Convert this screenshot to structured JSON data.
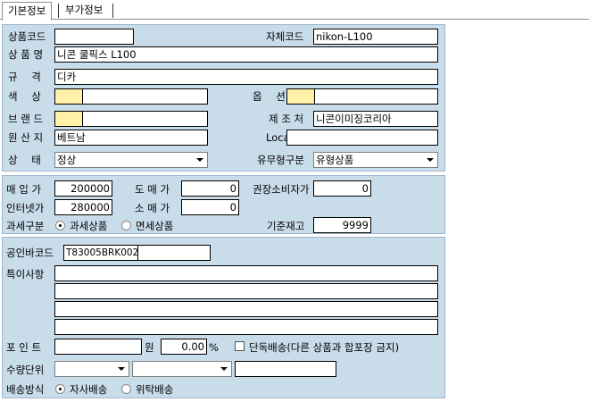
{
  "tabs": [
    {
      "label": "기본정보",
      "active": true
    },
    {
      "label": "부가정보",
      "active": false
    }
  ],
  "basic": {
    "product_code": {
      "label": "상품코드",
      "value": ""
    },
    "own_code": {
      "label": "자체코드",
      "value": "nikon-L100"
    },
    "product_name": {
      "label": "상 품 명",
      "value": "니콘 쿨픽스 L100"
    },
    "spec": {
      "label": "규     격",
      "value": "디카"
    },
    "color": {
      "label": "색     상",
      "value": ""
    },
    "option": {
      "label": "옵     션",
      "value": ""
    },
    "brand": {
      "label": "브 랜 드",
      "value": ""
    },
    "maker": {
      "label": "제 조 처",
      "value": "니콘이미징코리아"
    },
    "origin": {
      "label": "원 산 지",
      "value": "베트남"
    },
    "location": {
      "label": "Location",
      "value": ""
    },
    "status": {
      "label": "상     태",
      "value": "정상"
    },
    "type": {
      "label": "유무형구분",
      "value": "유형상품"
    }
  },
  "price": {
    "purchase": {
      "label": "매 입 가",
      "value": "200000"
    },
    "wholesale": {
      "label": "도 매 가",
      "value": "0"
    },
    "msrp": {
      "label": "권장소비자가",
      "value": "0"
    },
    "online": {
      "label": "인터넷가",
      "value": "280000"
    },
    "retail": {
      "label": "소 매 가",
      "value": "0"
    },
    "tax_label": "과세구분",
    "tax_options": [
      "과세상품",
      "면세상품"
    ],
    "tax_selected": 0,
    "stock": {
      "label": "기준재고",
      "value": "9999"
    }
  },
  "extra": {
    "barcode": {
      "label": "공인바코드",
      "value": "T83005BRK002",
      "value2": ""
    },
    "notes": {
      "label": "특이사항",
      "lines": [
        "",
        "",
        "",
        ""
      ]
    },
    "point": {
      "label": "포 인 트",
      "value": "",
      "unit": "원",
      "rate": "0.00",
      "rate_unit": "%"
    },
    "single_ship": {
      "label": "단독배송(다른 상품과 합포장 금지)",
      "checked": false
    },
    "qty_unit": {
      "label": "수량단위",
      "select1": "",
      "select2": "",
      "text": ""
    },
    "ship_method": {
      "label": "배송방식",
      "options": [
        "자사배송",
        "위탁배송"
      ],
      "selected": 0
    }
  }
}
